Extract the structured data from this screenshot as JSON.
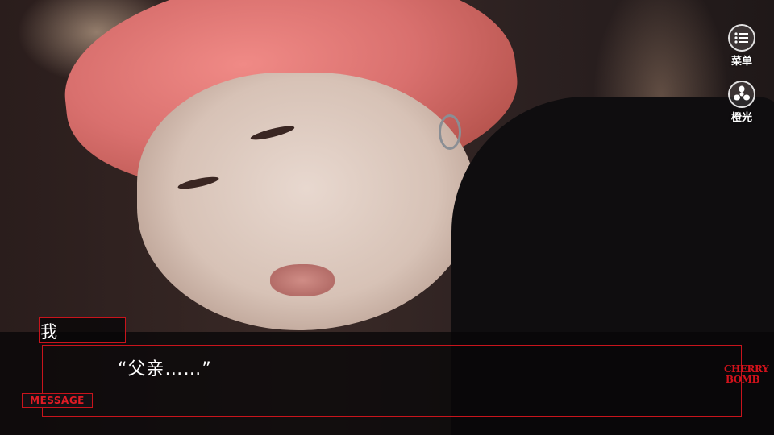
{
  "menu": {
    "label": "菜单",
    "icon": "list-icon"
  },
  "auto_light": {
    "label": "橙光",
    "icon": "orange-light-icon"
  },
  "dialog": {
    "speaker": "我",
    "text": "“父亲……”",
    "message_tag": "MESSAGE"
  },
  "logo": {
    "line1": "CHERRY",
    "line2": "BOMB"
  },
  "colors": {
    "frame_red": "#c8141c",
    "text_white": "#ffffff"
  }
}
